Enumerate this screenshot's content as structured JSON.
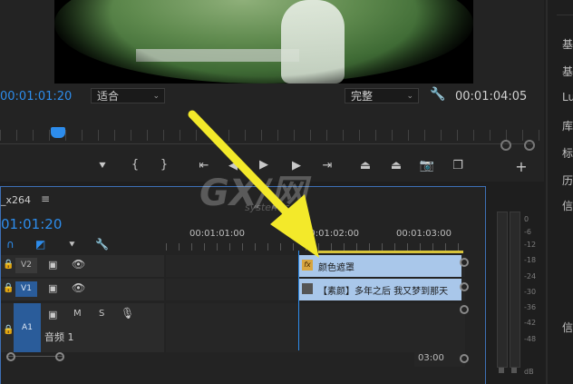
{
  "monitor": {
    "timecode_current": "00:01:01:20",
    "fit": "适合",
    "quality": "完整",
    "timecode_duration": "00:01:04:05"
  },
  "timeline": {
    "sequence_name": "_x264",
    "menu_icon": "hamburger",
    "timecode": "01:01:20",
    "ruler_ticks": [
      "00:01:01:00",
      "00:01:02:00",
      "00:01:03:00"
    ],
    "scroll_label": "03:00",
    "tracks": [
      {
        "id": "V2",
        "label": ""
      },
      {
        "id": "V1",
        "label": ""
      },
      {
        "id": "A1",
        "label": "音频 1",
        "m": "M",
        "s": "S"
      }
    ],
    "clips": {
      "effect_clip": "颜色遮罩",
      "video_clip": "【素颜】多年之后 我又梦到那天"
    }
  },
  "meter": {
    "db_labels": [
      "0",
      "-6",
      "-12",
      "-18",
      "-24",
      "-30",
      "-36",
      "-42",
      "-48",
      "dB"
    ]
  },
  "right_panel": {
    "items": [
      "基",
      "基",
      "Lu",
      "库",
      "标",
      "历",
      "信",
      "信"
    ]
  },
  "watermark": {
    "logo": "GX/网",
    "site": "system.com"
  },
  "colors": {
    "accent_blue": "#2d8ceb",
    "clip_blue": "#a9c7ea",
    "arrow_yellow": "#f3e92a"
  }
}
